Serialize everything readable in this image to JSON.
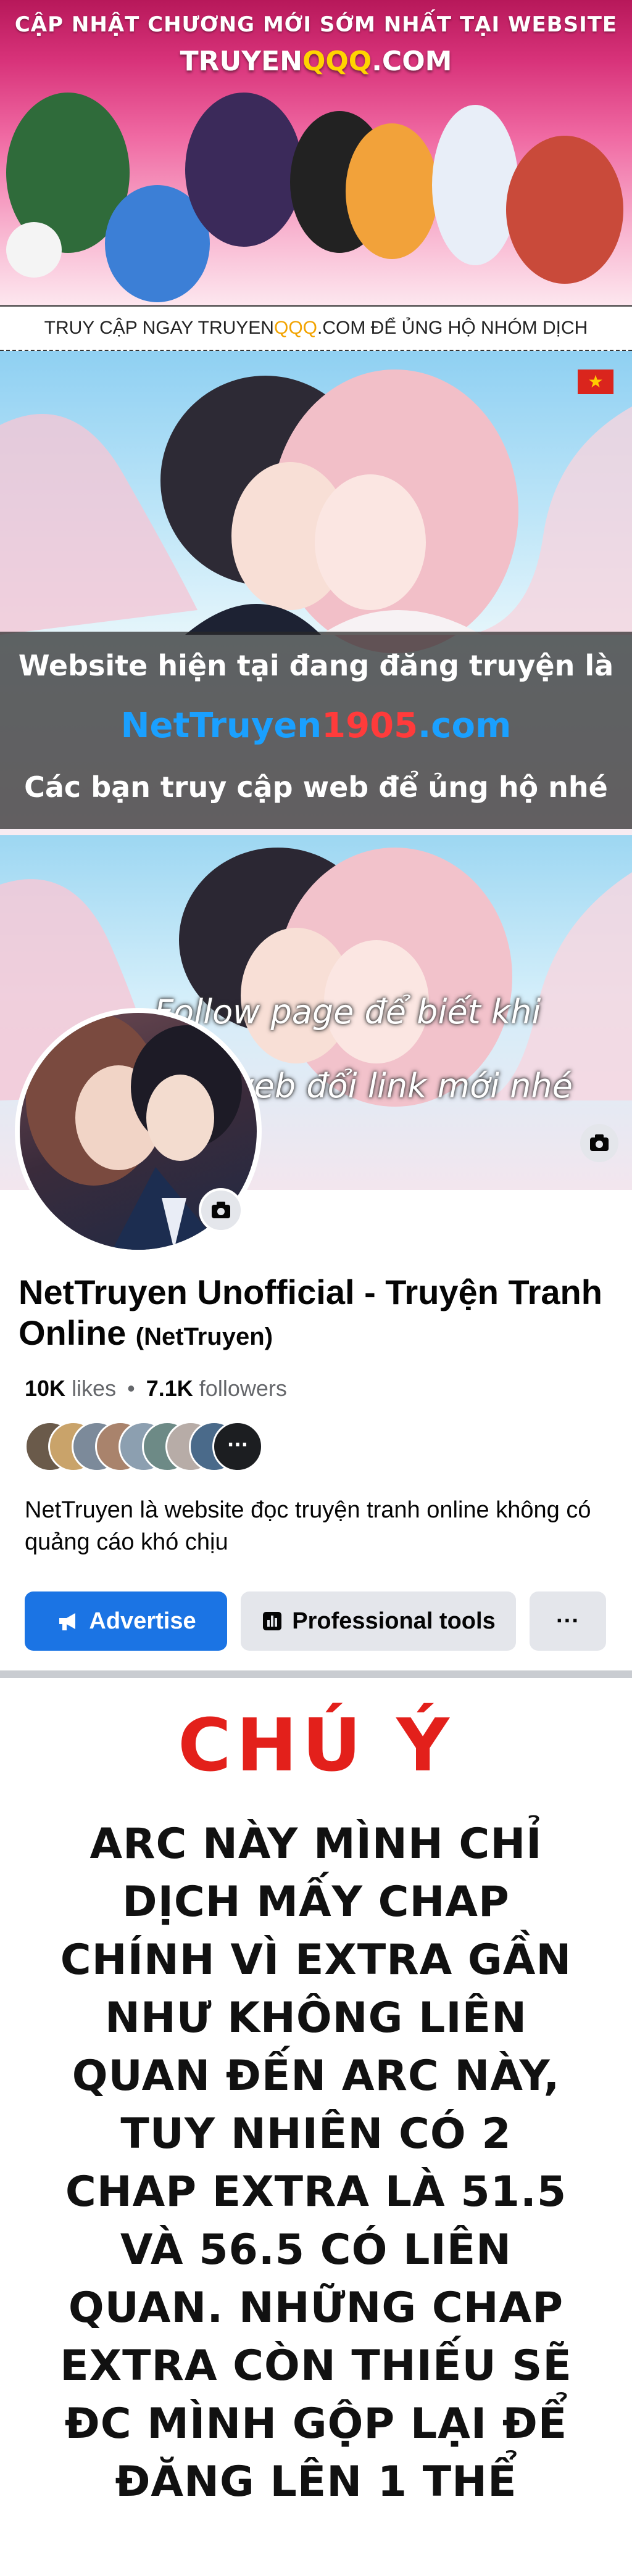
{
  "banner": {
    "line1": "CẬP NHẬT CHƯƠNG MỚI SỚM NHẤT TẠI WEBSITE",
    "site_prefix": "TRUYEN",
    "site_highlight": "QQQ",
    "site_suffix": ".COM"
  },
  "strip": {
    "prefix": "TRUY CẬP NGAY TRUYEN",
    "highlight": "QQQ",
    "suffix": ".COM ĐỂ ỦNG HỘ NHÓM DỊCH"
  },
  "promo": {
    "line1": "Website hiện tại đang đăng truyện là",
    "domain_prefix": "NetTruyen",
    "domain_number": "1905",
    "domain_suffix": ".com",
    "line3": "Các bạn truy cập web để ủng hộ nhé"
  },
  "facebook": {
    "cover_text_line1": "Follow page để biết khi",
    "cover_text_line2": "nào web đổi link mới nhé",
    "page_name": "NetTruyen Unofficial - Truyện Tranh Online",
    "username": "(NetTruyen)",
    "likes_count": "10K",
    "likes_label": "likes",
    "dot": "•",
    "followers_count": "7.1K",
    "followers_label": "followers",
    "description": "NetTruyen là website đọc truyện tranh online không có quảng cáo khó chịu",
    "buttons": {
      "advertise": "Advertise",
      "professional_tools": "Professional tools",
      "more": "···"
    },
    "icons": {
      "megaphone": "megaphone-icon",
      "chart": "chart-icon",
      "camera": "camera-icon"
    }
  },
  "note": {
    "title": "CHÚ Ý",
    "lines": [
      "ARC NÀY MÌNH CHỈ",
      "DỊCH MẤY CHAP",
      "CHÍNH VÌ EXTRA GẦN",
      "NHƯ KHÔNG LIÊN",
      "QUAN ĐẾN ARC NÀY,",
      "TUY NHIÊN CÓ 2",
      "CHAP EXTRA LÀ 51.5",
      "VÀ 56.5 CÓ LIÊN",
      "QUAN. NHỮNG CHAP",
      "EXTRA CÒN THIẾU SẼ",
      "ĐC MÌNH GỘP LẠI ĐỂ",
      "ĐĂNG LÊN 1 THỂ"
    ]
  },
  "colors": {
    "facebook_blue": "#1b74e4",
    "note_red": "#e3201b",
    "banner_pink": "#d8337a"
  }
}
